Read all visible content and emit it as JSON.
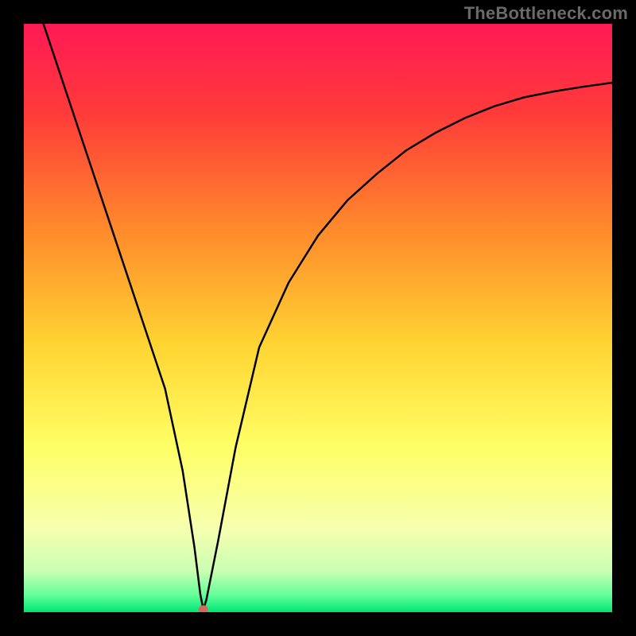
{
  "watermark": "TheBottleneck.com",
  "chart_data": {
    "type": "line",
    "title": "",
    "xlabel": "",
    "ylabel": "",
    "xlim": [
      0,
      100
    ],
    "ylim": [
      0,
      100
    ],
    "background_gradient": {
      "stops": [
        {
          "offset": 0.0,
          "color": "#ff1a55"
        },
        {
          "offset": 0.15,
          "color": "#ff3a3a"
        },
        {
          "offset": 0.35,
          "color": "#ff8a2b"
        },
        {
          "offset": 0.55,
          "color": "#ffd633"
        },
        {
          "offset": 0.72,
          "color": "#ffff66"
        },
        {
          "offset": 0.86,
          "color": "#f6ffb0"
        },
        {
          "offset": 0.93,
          "color": "#c9ffb3"
        },
        {
          "offset": 0.97,
          "color": "#66ff99"
        },
        {
          "offset": 1.0,
          "color": "#00e676"
        }
      ]
    },
    "series": [
      {
        "name": "bottleneck-curve",
        "stroke": "#000000",
        "x": [
          0,
          4,
          8,
          12,
          16,
          20,
          24,
          27,
          29,
          30,
          30.5,
          31,
          33,
          36,
          40,
          45,
          50,
          55,
          60,
          65,
          70,
          75,
          80,
          85,
          90,
          95,
          100
        ],
        "values": [
          110,
          98,
          86,
          74,
          62,
          50,
          38,
          24,
          11,
          3,
          0.5,
          2,
          12,
          28,
          45,
          56,
          64,
          70,
          74.5,
          78.5,
          81.5,
          84,
          86,
          87.5,
          88.5,
          89.3,
          90
        ]
      }
    ],
    "markers": [
      {
        "name": "optimum-point",
        "x": 30.5,
        "y": 0.5,
        "rx": 6,
        "ry": 5,
        "fill": "#d46a5e"
      }
    ]
  }
}
